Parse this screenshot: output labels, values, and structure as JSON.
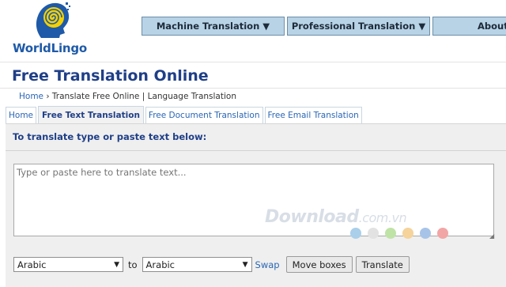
{
  "brand": {
    "name_part1": "World",
    "name_part2": "Lingo",
    "logo_icon": "worldlingo-head-spiral-logo"
  },
  "topnav": {
    "items": [
      {
        "label": "Machine Translation ▼"
      },
      {
        "label": "Professional Translation ▼"
      },
      {
        "label": "About"
      }
    ]
  },
  "page": {
    "title": "Free Translation Online"
  },
  "breadcrumb": {
    "home": "Home",
    "rest": " › Translate Free Online | Language Translation"
  },
  "tabs": [
    {
      "label": "Home",
      "active": false
    },
    {
      "label": "Free Text Translation",
      "active": true
    },
    {
      "label": "Free Document Translation",
      "active": false
    },
    {
      "label": "Free Email Translation",
      "active": false
    }
  ],
  "panel": {
    "heading": "To translate type or paste text below:",
    "source_placeholder": "Type or paste here to translate text..."
  },
  "controls": {
    "from_language": "Arabic",
    "to_label": "to",
    "to_language": "Arabic",
    "swap_label": "Swap",
    "move_boxes_label": "Move boxes",
    "translate_label": "Translate"
  },
  "watermark": {
    "text_main": "Download",
    "text_suffix": ".com.vn",
    "dot_colors": [
      "#a9cfea",
      "#e2e2e2",
      "#bfe3a6",
      "#f5d39a",
      "#a7c4e8",
      "#f2a5a5"
    ]
  },
  "colors": {
    "accent": "#1f3f87",
    "link": "#2a66b5",
    "nav_bg": "#b8d3e6"
  }
}
